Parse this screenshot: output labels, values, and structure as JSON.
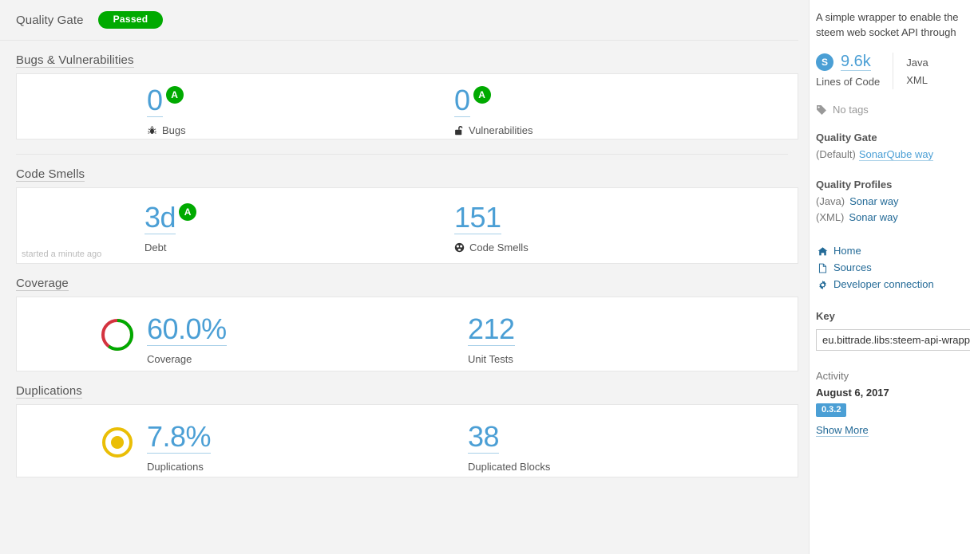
{
  "quality_gate": {
    "label": "Quality Gate",
    "status": "Passed",
    "status_color": "#00aa00"
  },
  "sections": [
    {
      "title": "Bugs & Vulnerabilities",
      "measures": [
        {
          "value": "0",
          "label": "Bugs",
          "icon": "bug-icon",
          "rating": "A",
          "rating_color": "#00aa00"
        },
        {
          "value": "0",
          "label": "Vulnerabilities",
          "icon": "open-lock-icon",
          "rating": "A",
          "rating_color": "#00aa00"
        }
      ]
    },
    {
      "title": "Code Smells",
      "footnote": "started a minute ago",
      "measures": [
        {
          "value": "3d",
          "label": "Debt",
          "icon": "",
          "rating": "A",
          "rating_color": "#00aa00"
        },
        {
          "value": "151",
          "label": "Code Smells",
          "icon": "code-smell-icon",
          "rating": "",
          "rating_color": ""
        }
      ]
    },
    {
      "title": "Coverage",
      "measures": [
        {
          "value": "60.0%",
          "label": "Coverage",
          "icon": "",
          "rating": "",
          "rating_color": ""
        },
        {
          "value": "212",
          "label": "Unit Tests",
          "icon": "",
          "rating": "",
          "rating_color": ""
        }
      ]
    },
    {
      "title": "Duplications",
      "measures": [
        {
          "value": "7.8%",
          "label": "Duplications",
          "icon": "",
          "rating": "",
          "rating_color": ""
        },
        {
          "value": "38",
          "label": "Duplicated Blocks",
          "icon": "",
          "rating": "",
          "rating_color": ""
        }
      ]
    }
  ],
  "charts": {
    "coverage": {
      "percent": 60.0,
      "covered_color": "#00aa00",
      "uncovered_color": "#d4333f"
    },
    "duplications": {
      "percent": 7.8,
      "color": "#eabe06"
    }
  },
  "sidebar": {
    "description_line1": "A simple wrapper to enable the",
    "description_line2": "steem web socket API through",
    "size_badge": "S",
    "ncloc_value": "9.6k",
    "ncloc_label": "Lines of Code",
    "languages": [
      "Java",
      "XML"
    ],
    "tags_text": "No tags",
    "quality_gate_heading": "Quality Gate",
    "quality_gate_default": "(Default)",
    "quality_gate_name": "SonarQube way",
    "quality_profiles_heading": "Quality Profiles",
    "quality_profiles": [
      {
        "lang": "(Java)",
        "name": "Sonar way"
      },
      {
        "lang": "(XML)",
        "name": "Sonar way"
      }
    ],
    "links": [
      {
        "label": "Home",
        "icon": "home-icon"
      },
      {
        "label": "Sources",
        "icon": "file-icon"
      },
      {
        "label": "Developer connection",
        "icon": "gear-icon"
      }
    ],
    "key_heading": "Key",
    "key_value": "eu.bittrade.libs:steem-api-wrapper",
    "activity_heading": "Activity",
    "activity_date": "August 6, 2017",
    "activity_version": "0.3.2",
    "show_more": "Show More"
  }
}
